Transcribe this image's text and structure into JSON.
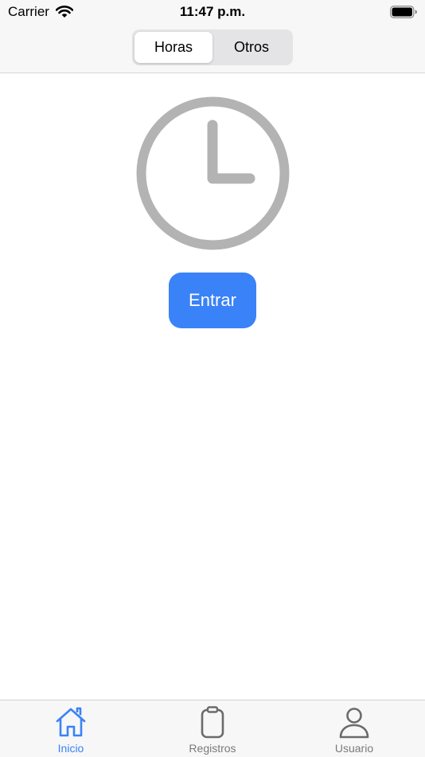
{
  "status_bar": {
    "carrier": "Carrier",
    "time": "11:47 p.m.",
    "icons": [
      "wifi-icon",
      "battery-icon"
    ]
  },
  "segmented_control": {
    "segments": [
      "Horas",
      "Otros"
    ],
    "selected": "Horas"
  },
  "main": {
    "icon": "clock-icon",
    "enter_label": "Entrar"
  },
  "tab_bar": {
    "items": [
      {
        "label": "Inicio",
        "icon": "house-icon",
        "active": true
      },
      {
        "label": "Registros",
        "icon": "clipboard-icon",
        "active": false
      },
      {
        "label": "Usuario",
        "icon": "person-icon",
        "active": false
      }
    ]
  },
  "colors": {
    "accent": "#3a82f7",
    "clock_gray": "#b3b3b3",
    "bar_background": "#f7f7f7",
    "inactive_tab": "#7a7a7a"
  }
}
